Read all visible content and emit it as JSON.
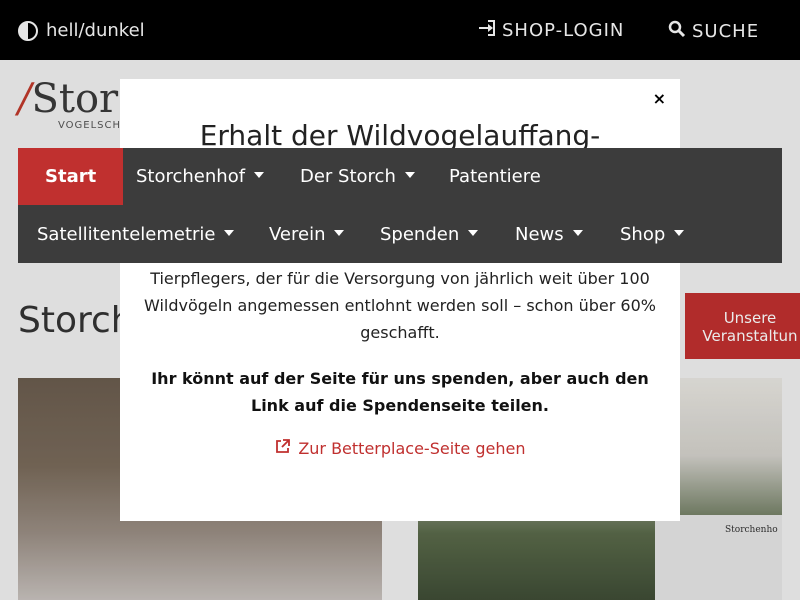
{
  "topbar": {
    "theme_toggle": "hell/dunkel",
    "shop_login": "SHOP-LOGIN",
    "search": "SUCHE"
  },
  "logo": {
    "text": "Storch",
    "sub": "VOGELSCH"
  },
  "page": {
    "heading": "Storch",
    "events_button": "Unsere Veranstaltun",
    "photo_sign": "Storchenho"
  },
  "modal": {
    "close": "×",
    "title": "Erhalt der Wildvogelauffang-",
    "text": "Tierpflegers, der für die Versorgung von jährlich weit über 100 Wildvögeln angemessen entlohnt werden soll – schon über 60% geschafft.",
    "bold": "Ihr könnt auf der Seite für uns spenden, aber auch den Link auf die Spendenseite teilen.",
    "link": "Zur Betterplace-Seite gehen"
  },
  "nav": {
    "start": "Start",
    "storchenhof": "Storchenhof",
    "der_storch": "Der Storch",
    "patentiere": "Patentiere",
    "satellitentelemetrie": "Satellitentelemetrie",
    "verein": "Verein",
    "spenden": "Spenden",
    "news": "News",
    "shop": "Shop"
  },
  "icons": {
    "theme": "half-circle-icon",
    "login": "sign-in-icon",
    "search": "search-icon",
    "external": "external-link-icon",
    "caret": "caret-down-icon"
  },
  "colors": {
    "accent": "#c0302f",
    "topbar": "#000000",
    "nav": "#3c3c3c"
  }
}
